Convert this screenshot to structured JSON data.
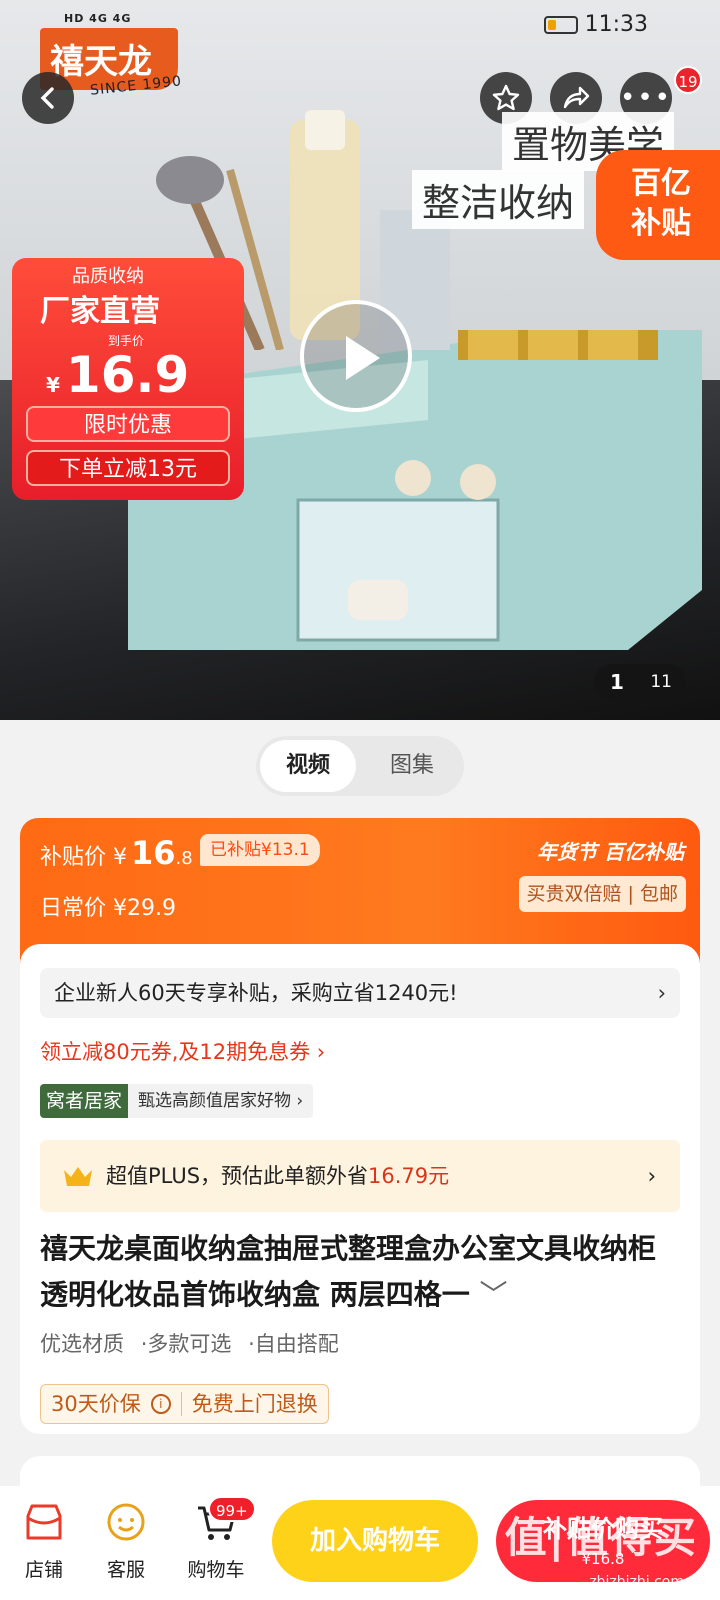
{
  "status": {
    "indicators": "HD 4G 4G",
    "time": "11:33"
  },
  "hero": {
    "brand": "禧天龙",
    "brand_sub": "SINCE 1990",
    "tagline_1": "置物美学",
    "tagline_2": "整洁收纳",
    "subsidy_badge_1": "百亿",
    "subsidy_badge_2": "补贴",
    "notif_count": "19",
    "promo": {
      "line1": "品质收纳",
      "line2": "厂家直营",
      "price_label": "到手价",
      "currency": "¥",
      "price": "16.9",
      "pill1": "限时优惠",
      "pill2": "下单立减13元"
    },
    "pager_current": "1",
    "pager_total": "11"
  },
  "media_tabs": [
    "视频",
    "图集"
  ],
  "price": {
    "subsidy_label": "补贴价",
    "subsidy_currency": "¥",
    "subsidy_int": "16",
    "subsidy_dec": ".8",
    "subsidized_tag": "已补贴¥13.1",
    "daily_label": "日常价",
    "daily_value": "¥29.9",
    "event_label": "年货节 百亿补贴",
    "guarantee": "买贵双倍赔 | 包邮"
  },
  "promo_notice": "企业新人60天专享补贴，采购立省1240元!",
  "coupon_text": "领立减80元券,及12期免息券 ›",
  "tag_group": "窝者居家",
  "tag_text": "甄选高颜值居家好物 ›",
  "plus": {
    "prefix": "超值PLUS，预估此单额外省",
    "amount": "16.79元"
  },
  "product_title": "禧天龙桌面收纳盒抽屉式整理盒办公室文具收纳柜透明化妆品首饰收纳盒 两层四格一",
  "features": [
    "优选材质",
    "·多款可选",
    "·自由搭配"
  ],
  "services": [
    "30天价保",
    "免费上门退换"
  ],
  "bottom_nav": [
    "店铺",
    "客服",
    "购物车"
  ],
  "cart_badge": "99+",
  "add_to_cart": "加入购物车",
  "buy_now": "补贴价购买",
  "buy_price": "¥16.8",
  "watermark": "值|值得买",
  "watermark_sub": "zhizhizhi.com",
  "colors": {
    "accent": "#ff6a14",
    "red": "#e8242c",
    "yellow": "#ffd21a"
  }
}
